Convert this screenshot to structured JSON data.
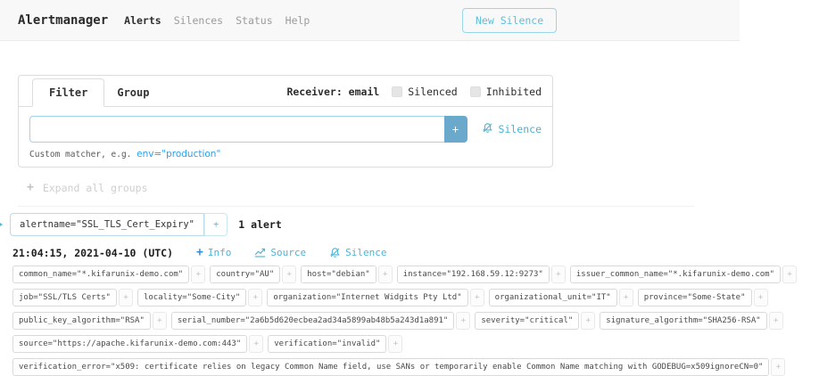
{
  "navbar": {
    "brand": "Alertmanager",
    "items": [
      {
        "label": "Alerts",
        "active": true
      },
      {
        "label": "Silences",
        "active": false
      },
      {
        "label": "Status",
        "active": false
      },
      {
        "label": "Help",
        "active": false
      }
    ],
    "new_silence_label": "New Silence"
  },
  "filter_card": {
    "tabs": [
      {
        "label": "Filter",
        "active": true
      },
      {
        "label": "Group",
        "active": false
      }
    ],
    "receiver_label": "Receiver: email",
    "checkboxes": [
      {
        "label": "Silenced",
        "checked": false
      },
      {
        "label": "Inhibited",
        "checked": false
      }
    ],
    "matcher_input": {
      "value": "",
      "placeholder": ""
    },
    "add_button_label": "+",
    "silence_link_label": "Silence",
    "helper_prefix": "Custom matcher, e.g.",
    "helper_example": "env=\"production\""
  },
  "expand_all": {
    "icon": "plus-icon",
    "label": "Expand all groups"
  },
  "group": {
    "matcher": "alertname=\"SSL_TLS_Cert_Expiry\"",
    "plus_label": "+",
    "count_label": "1 alert"
  },
  "alert": {
    "timestamp": "21:04:15, 2021-04-10 (UTC)",
    "actions": [
      {
        "label": "Info",
        "icon": "plus-icon"
      },
      {
        "label": "Source",
        "icon": "chart-icon"
      },
      {
        "label": "Silence",
        "icon": "bell-slash-icon"
      }
    ],
    "label_plus": "+",
    "labels": [
      "common_name=\"*.kifarunix-demo.com\"",
      "country=\"AU\"",
      "host=\"debian\"",
      "instance=\"192.168.59.12:9273\"",
      "issuer_common_name=\"*.kifarunix-demo.com\"",
      "job=\"SSL/TLS Certs\"",
      "locality=\"Some-City\"",
      "organization=\"Internet Widgits Pty Ltd\"",
      "organizational_unit=\"IT\"",
      "province=\"Some-State\"",
      "public_key_algorithm=\"RSA\"",
      "serial_number=\"2a6b5d620ecbea2ad34a5899ab48b5a243d1a891\"",
      "severity=\"critical\"",
      "signature_algorithm=\"SHA256-RSA\"",
      "source=\"https://apache.kifarunix-demo.com:443\"",
      "verification=\"invalid\"",
      "verification_error=\"x509: certificate relies on legacy Common Name field, use SANs or temporarily enable Common Name matching with GODEBUG=x509ignoreCN=0\""
    ]
  },
  "colors": {
    "navbar_bg": "#f8f8f8",
    "accent_teal": "#5bc0de",
    "link_blue": "#2b8fd9",
    "add_button_bg": "#6aa9cb",
    "tag_border": "#d9d9d9",
    "group_tag_border": "#b9dde9"
  }
}
